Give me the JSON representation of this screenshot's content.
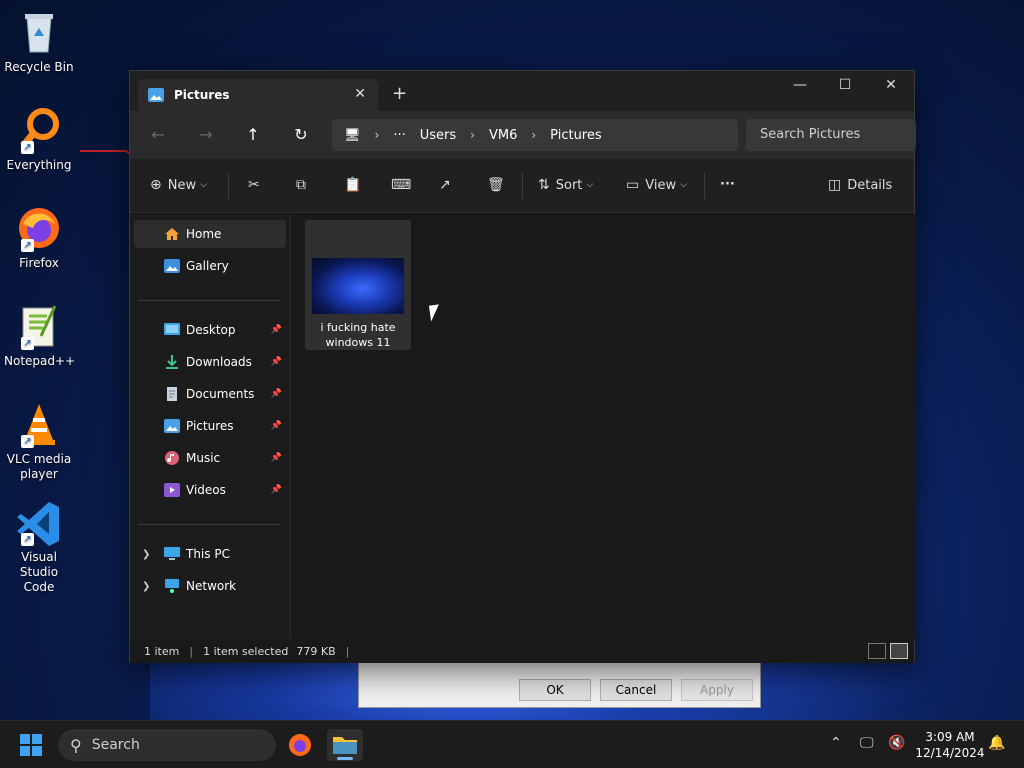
{
  "desktop": {
    "icons": [
      {
        "label": "Recycle Bin",
        "icon": "recycle-bin-icon"
      },
      {
        "label": "Everything",
        "icon": "everything-search-icon"
      },
      {
        "label": "Firefox",
        "icon": "firefox-icon"
      },
      {
        "label": "Notepad++",
        "icon": "notepad-plus-plus-icon"
      },
      {
        "label": "VLC media player",
        "icon": "vlc-cone-icon"
      },
      {
        "label": "Visual Studio Code",
        "icon": "vscode-icon"
      }
    ]
  },
  "dialog": {
    "ok": "OK",
    "cancel": "Cancel",
    "apply": "Apply"
  },
  "explorer": {
    "tab_title": "Pictures",
    "breadcrumbs": [
      "Users",
      "VM6",
      "Pictures"
    ],
    "more_crumbs": "···",
    "search_placeholder": "Search Pictures",
    "toolbar": {
      "new": "New",
      "sort": "Sort",
      "view": "View",
      "more": "···",
      "details": "Details"
    },
    "nav": {
      "home": "Home",
      "gallery": "Gallery",
      "quick_access": [
        "Desktop",
        "Downloads",
        "Documents",
        "Pictures",
        "Music",
        "Videos"
      ],
      "this_pc": "This PC",
      "network": "Network"
    },
    "files": [
      {
        "name": "i fucking hate windows 11"
      }
    ],
    "status": {
      "items": "1 item",
      "selected": "1 item selected",
      "size": "779 KB"
    }
  },
  "taskbar": {
    "search_label": "Search",
    "time": "3:09 AM",
    "date": "12/14/2024"
  },
  "colors": {
    "accent": "#3ea3f5",
    "window_bg": "#191919",
    "toolbar_bg": "#202020"
  }
}
